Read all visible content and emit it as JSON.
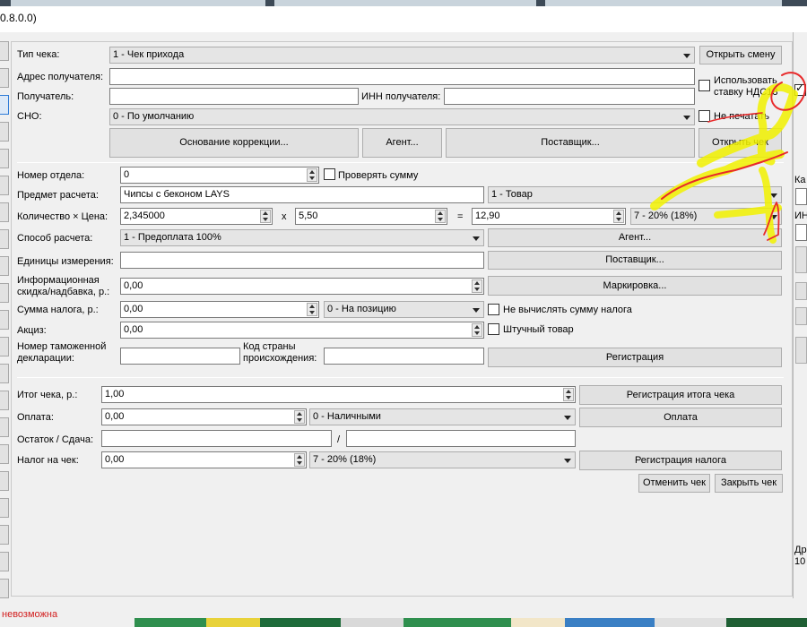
{
  "window": {
    "title": "0.8.0.0)"
  },
  "receipt": {
    "type_label": "Тип чека:",
    "type_value": "1 - Чек прихода",
    "open_shift": "Открыть смену",
    "address_label": "Адрес получателя:",
    "address_value": "",
    "recipient_label": "Получатель:",
    "recipient_value": "",
    "inn_label": "ИНН получателя:",
    "inn_value": "",
    "vat_checkbox_label": "Использовать ставку НДС18",
    "sno_label": "СНО:",
    "sno_value": "0 - По умолчанию",
    "no_print_label": "Не печатать",
    "correction_basis": "Основание коррекции...",
    "agent": "Агент...",
    "supplier": "Поставщик...",
    "open_check": "Открыть чек"
  },
  "position": {
    "dept_label": "Номер отдела:",
    "dept_value": "0",
    "check_sum_label": "Проверять сумму",
    "subject_label": "Предмет расчета:",
    "subject_value": "Чипсы с беконом LAYS",
    "subject_type": "1 - Товар",
    "qty_price_label": "Количество × Цена:",
    "qty_value": "2,345000",
    "times": "x",
    "price_value": "5,50",
    "equals": "=",
    "total_value": "12,90",
    "vat_rate": "7 - 20% (18%)",
    "payment_method_label": "Способ расчета:",
    "payment_method_value": "1 - Предоплата 100%",
    "agent": "Агент...",
    "units_label": "Единицы измерения:",
    "units_value": "",
    "supplier": "Поставщик...",
    "discount_label": "Информационная скидка/надбавка, р.:",
    "discount_value": "0,00",
    "marking": "Маркировка...",
    "tax_sum_label": "Сумма налога, р.:",
    "tax_sum_value": "0,00",
    "tax_mode": "0 - На позицию",
    "no_calc_tax_label": "Не вычислять сумму налога",
    "excise_label": "Акциз:",
    "excise_value": "0,00",
    "piece_goods_label": "Штучный товар",
    "customs_label": "Номер таможенной декларации:",
    "customs_value": "",
    "country_label": "Код страны происхождения:",
    "country_value": "",
    "register": "Регистрация"
  },
  "totals": {
    "total_label": "Итог чека, р.:",
    "total_value": "1,00",
    "register_total": "Регистрация итога чека",
    "payment_label": "Оплата:",
    "payment_value": "0,00",
    "payment_type": "0 - Наличными",
    "pay_button": "Оплата",
    "change_label": "Остаток / Сдача:",
    "rest_value": "",
    "slash": "/",
    "change_value": "",
    "tax_label": "Налог на чек:",
    "tax_value": "0,00",
    "tax_rate": "7 - 20% (18%)",
    "register_tax": "Регистрация налога",
    "cancel_check": "Отменить чек",
    "close_check": "Закрыть чек"
  },
  "right_panel": {
    "label1": "Ка",
    "label2": "ИН",
    "label3": "Др",
    "label4": "10"
  },
  "status": {
    "text": "невозможна"
  },
  "colors": {
    "status_error": "#d21e1e",
    "highlighter": "#f2f200",
    "pen": "#e8292a"
  }
}
